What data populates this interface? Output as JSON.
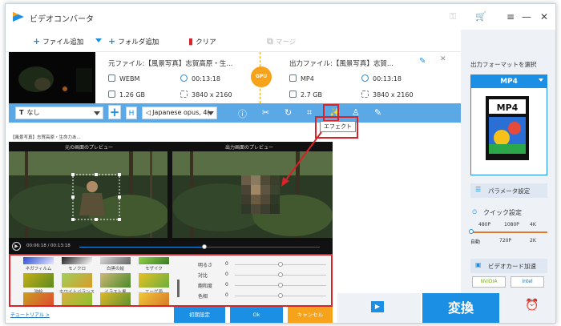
{
  "app": {
    "title": "ビデオコンバータ"
  },
  "titlebar": {
    "key_icon": "key-icon",
    "cart_icon": "cart-icon",
    "menu_icon": "menu-icon",
    "minimize_icon": "minimize-icon",
    "close_icon": "close-icon"
  },
  "toolbar": {
    "add_file": "ファイル追加",
    "add_folder": "フォルダ追加",
    "clear": "クリア",
    "merge": "マージ"
  },
  "file": {
    "source_label": "元ファイル:【風景写真】志賀高原・生...",
    "output_label": "出力ファイル:【風景写真】志賀...",
    "source_format": "WEBM",
    "source_duration": "00:13:18",
    "source_size": "1.26 GB",
    "source_resolution": "3840 x 2160",
    "output_format": "MP4",
    "output_duration": "00:13:18",
    "output_size": "2.7 GB",
    "output_resolution": "3840 x 2160",
    "gpu": "GPU"
  },
  "editbar": {
    "subtitle": "なし",
    "audio": "Japanese opus, 4("
  },
  "tooltip": "エフェクト",
  "preview": {
    "file_label": "【風景写真】志賀高原・生命力あ...",
    "original_title": "元の画面のプレビュー",
    "output_title": "出力画面のプレビュー",
    "time": "00:06:18 / 00:13:18",
    "progress": 0.52
  },
  "effects": {
    "items": [
      "ネガフィルム",
      "モノクロ",
      "白黒の絵",
      "モザイク",
      "油絵",
      "ホワイトバランス",
      "イラスト風",
      "エーゲ海",
      "",
      "",
      "",
      ""
    ],
    "sliders": [
      {
        "name": "明るさ",
        "value": "0",
        "level": 0.5
      },
      {
        "name": "対比",
        "value": "0",
        "level": 0.5
      },
      {
        "name": "飽和度",
        "value": "0",
        "level": 0.5
      },
      {
        "name": "色相",
        "value": "0",
        "level": 0.5
      }
    ],
    "reset": "初期設定",
    "ok": "Ok",
    "cancel": "キャンセル"
  },
  "tutorial": "チュートリアル >",
  "right": {
    "select_format": "出力フォーマットを選択",
    "format": "MP4",
    "params": "パラメータ設定",
    "quick": "クイック設定",
    "res_top": [
      "480P",
      "1080P",
      "4K"
    ],
    "res_bottom": [
      "自動",
      "720P",
      "2K"
    ],
    "gpu_accel": "ビデオカード加速",
    "nvidia": "NVIDIA",
    "intel": "Intel"
  },
  "convert": "変換",
  "colors": {
    "accent": "#1a8fe3",
    "highlight": "#d8232a",
    "orange": "#f6a21a"
  }
}
